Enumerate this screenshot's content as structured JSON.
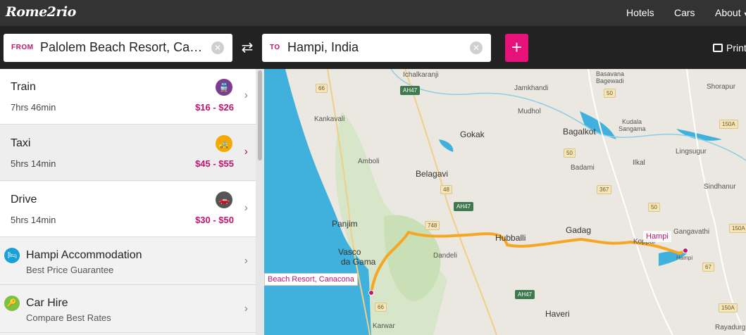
{
  "header": {
    "logo_text": "Rome2rio",
    "nav": {
      "hotels": "Hotels",
      "cars": "Cars",
      "about": "About"
    }
  },
  "search": {
    "from_tag": "FROM",
    "from_value": "Palolem Beach Resort, Canacona",
    "to_tag": "TO",
    "to_value": "Hampi, India",
    "swap_glyph": "⇄",
    "add_glyph": "+",
    "clear_glyph": "✕",
    "print_label": "Print"
  },
  "routes": [
    {
      "name": "Train",
      "duration": "7hrs 46min",
      "price": "$16 - $26",
      "icon": "train-icon",
      "icon_color": "#7a3d8f",
      "glyph": "🚆"
    },
    {
      "name": "Taxi",
      "duration": "5hrs 14min",
      "price": "$45 - $55",
      "icon": "taxi-icon",
      "icon_color": "#f5a900",
      "glyph": "🚕"
    },
    {
      "name": "Drive",
      "duration": "5hrs 14min",
      "price": "$30 - $50",
      "icon": "car-icon",
      "icon_color": "#555555",
      "glyph": "🚗"
    }
  ],
  "extras": [
    {
      "title": "Hampi Accommodation",
      "subtitle": "Best Price Guarantee",
      "icon": "bed-icon",
      "icon_color": "#1b9fd8",
      "glyph": "🛏"
    },
    {
      "title": "Car Hire",
      "subtitle": "Compare Best Rates",
      "icon": "key-icon",
      "icon_color": "#7cc242",
      "glyph": "🔑"
    }
  ],
  "colors": {
    "accent": "#c2156e",
    "add_button": "#e6127a",
    "route_line": "#f5a623",
    "water": "#3fb1dc"
  },
  "map": {
    "places": {
      "ichalkaranji": "Ichalkaranji",
      "jamkhandi": "Jamkhandi",
      "mudhol": "Mudhol",
      "gokak": "Gokak",
      "bagalkot": "Bagalkot",
      "kankavali": "Kankavali",
      "amboli": "Amboli",
      "belagavi": "Belagavi",
      "badami": "Badami",
      "ilkal": "Ilkal",
      "lingsugur": "Lingsugur",
      "sindhanur": "Sindhanur",
      "shorapur": "Shorapur",
      "basavana": "Basavana",
      "bagewadi": "Bagewadi",
      "kudala": "Kudala",
      "sangama": "Sangama",
      "panjim": "Panjim",
      "vasco1": "Vasco",
      "vasco2": "da Gama",
      "dandeli": "Dandeli",
      "hubballi": "Hubballi",
      "gadag": "Gadag",
      "koppal": "Koppal",
      "gangavathi": "Gangavathi",
      "hampi_small": "Hampi",
      "haveri": "Haveri",
      "karwar": "Karwar",
      "rayadurg": "Rayadurg"
    },
    "shields": {
      "s66a": "66",
      "ah47a": "AH47",
      "s50a": "50",
      "s50b": "50",
      "s48a": "48",
      "s748": "748",
      "ah47b": "AH47",
      "s367": "367",
      "s150a": "150A",
      "s50c": "50",
      "s150b": "150A",
      "s67": "67",
      "ah47c": "AH47",
      "s66b": "66",
      "s150c": "150A"
    },
    "pin_from": "Beach Resort, Canacona",
    "pin_to": "Hampi"
  }
}
